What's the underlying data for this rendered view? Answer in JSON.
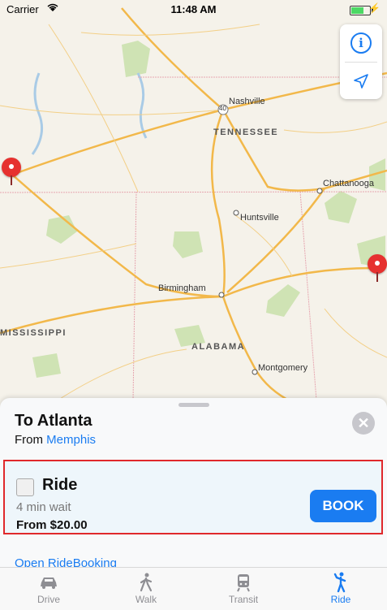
{
  "status": {
    "carrier": "Carrier",
    "time": "11:48 AM"
  },
  "map": {
    "labels": {
      "nashville": "Nashville",
      "tennessee": "TENNESSEE",
      "chattanooga": "Chattanooga",
      "huntsville": "Huntsville",
      "birmingham": "Birmingham",
      "mississippi": "MISSISSIPPI",
      "alabama": "ALABAMA",
      "montgomery": "Montgomery",
      "hwy40": "40"
    },
    "controls": {
      "info": "i",
      "locate": "location-arrow-icon"
    }
  },
  "sheet": {
    "title": "To Atlanta",
    "from_prefix": "From",
    "from_city": "Memphis",
    "close_icon": "close-icon",
    "ride": {
      "name": "Ride",
      "wait": "4 min wait",
      "price": "From $20.00",
      "book_label": "BOOK"
    },
    "open_link": "Open RideBooking"
  },
  "tabs": [
    {
      "label": "Drive",
      "icon": "car-icon"
    },
    {
      "label": "Walk",
      "icon": "walk-icon"
    },
    {
      "label": "Transit",
      "icon": "train-icon"
    },
    {
      "label": "Ride",
      "icon": "ride-icon",
      "active": true
    }
  ],
  "colors": {
    "accent": "#1a7cf1",
    "pin": "#e6312f",
    "highlight": "#e0282b"
  }
}
